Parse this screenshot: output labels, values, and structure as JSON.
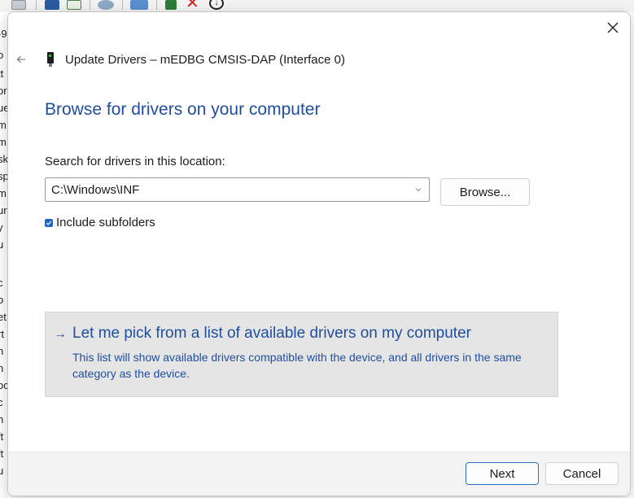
{
  "colors": {
    "accent_text": "#1f4e9e",
    "primary_button_border": "#2d6cc0",
    "checkbox_fill": "#1f67c5",
    "option_panel_bg": "#e5e5e5",
    "footer_bg": "#f3f3f3"
  },
  "background_app": {
    "toolbar_icons": [
      "properties-icon",
      "help-icon",
      "view-icon",
      "scan-hardware-icon",
      "monitor-icon",
      "update-driver-icon",
      "uninstall-icon",
      "disable-device-icon"
    ],
    "tree_fragments": [
      "-9",
      "o",
      "tt",
      "or",
      "ue",
      "m",
      "m",
      "sk",
      "sp",
      "m",
      "ur",
      "y",
      "u",
      "c",
      "o",
      "et",
      "rt",
      "n",
      "n",
      "oc",
      "c",
      "n",
      "ft",
      "ft",
      "u"
    ]
  },
  "dialog": {
    "close_icon": "close-icon",
    "back_icon": "back-arrow-icon",
    "window_title": "Update Drivers – mEDBG CMSIS-DAP (Interface 0)",
    "heading": "Browse for drivers on your computer",
    "search_label": "Search for drivers in this location:",
    "path_value": "C:\\Windows\\INF",
    "browse_label": "Browse...",
    "include_subfolders_label": "Include subfolders",
    "include_subfolders_checked": true,
    "pick_option": {
      "arrow": "→",
      "title": "Let me pick from a list of available drivers on my computer",
      "description": "This list will show available drivers compatible with the device, and all drivers in the same category as the device."
    },
    "footer": {
      "next_label": "Next",
      "cancel_label": "Cancel"
    }
  }
}
